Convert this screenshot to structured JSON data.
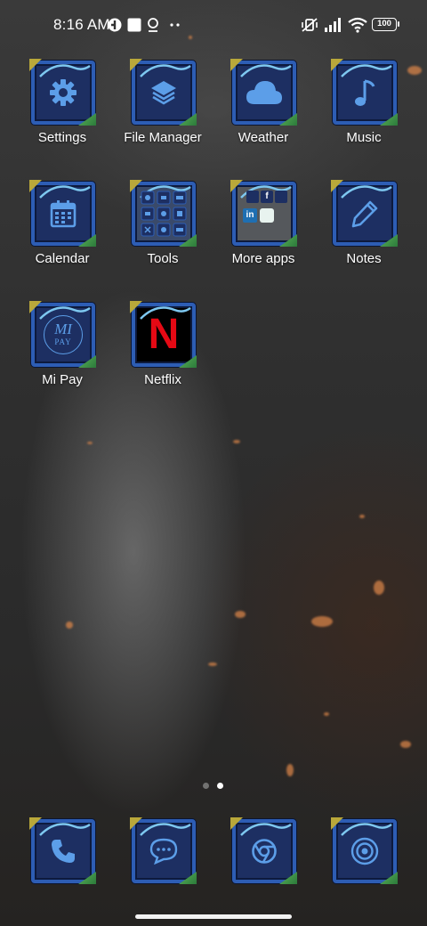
{
  "status_bar": {
    "time": "8:16 AM",
    "battery": "100",
    "left_icons": [
      "vpn-icon",
      "square-notification-icon",
      "location-icon",
      "more-notifications-icon"
    ],
    "right_icons": [
      "mute-vibrate-icon",
      "signal-icon",
      "wifi-icon",
      "battery-icon"
    ]
  },
  "apps": [
    {
      "label": "Settings",
      "icon": "gear-icon"
    },
    {
      "label": "File Manager",
      "icon": "layers-icon"
    },
    {
      "label": "Weather",
      "icon": "cloud-icon"
    },
    {
      "label": "Music",
      "icon": "music-note-icon"
    },
    {
      "label": "Calendar",
      "icon": "calendar-icon"
    },
    {
      "label": "Tools",
      "icon": "tools-folder-icon"
    },
    {
      "label": "More apps",
      "icon": "more-apps-folder-icon"
    },
    {
      "label": "Notes",
      "icon": "pencil-icon"
    },
    {
      "label": "Mi Pay",
      "icon": "mi-pay-icon",
      "icon_text": [
        "MI",
        "PAY"
      ]
    },
    {
      "label": "Netflix",
      "icon": "netflix-icon",
      "icon_text": "N"
    }
  ],
  "more_apps_folder": {
    "facebook": "f",
    "linkedin": "in"
  },
  "page_indicator": {
    "pages": 2,
    "current": 2
  },
  "dock": [
    {
      "icon": "phone-icon"
    },
    {
      "icon": "messages-icon"
    },
    {
      "icon": "browser-icon"
    },
    {
      "icon": "camera-icon"
    }
  ],
  "colors": {
    "tile_bg": "#1d2f62",
    "tile_border": "#2d5db4",
    "glyph": "#5c9ee8",
    "netflix_red": "#e50914"
  }
}
